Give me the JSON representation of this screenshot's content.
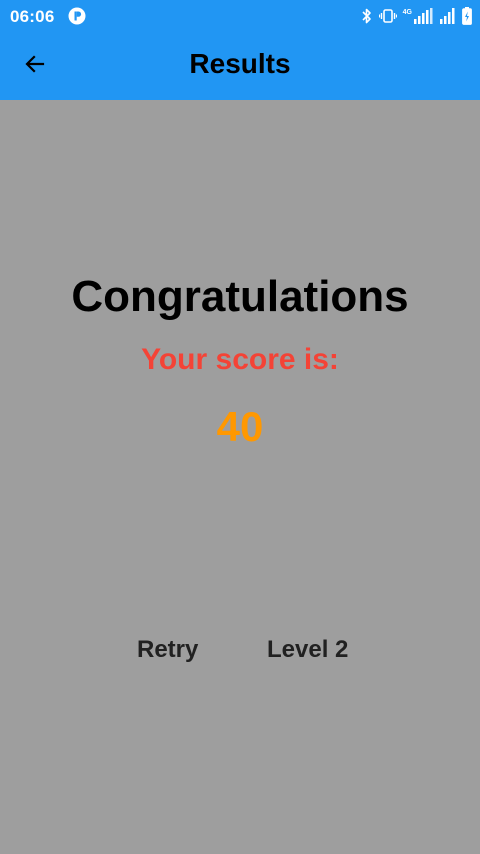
{
  "status_bar": {
    "time": "06:06",
    "network_label": "4G",
    "color": "#2196f3"
  },
  "app_bar": {
    "title": "Results",
    "back_icon": "arrow-left-icon",
    "color": "#2196f3"
  },
  "content": {
    "background": "#9e9e9e",
    "heading": "Congratulations",
    "score_label": "Your score is:",
    "score_value": "40",
    "score_label_color": "#f44336",
    "score_value_color": "#ff9800"
  },
  "actions": {
    "retry_label": "Retry",
    "next_level_label": "Level 2"
  }
}
